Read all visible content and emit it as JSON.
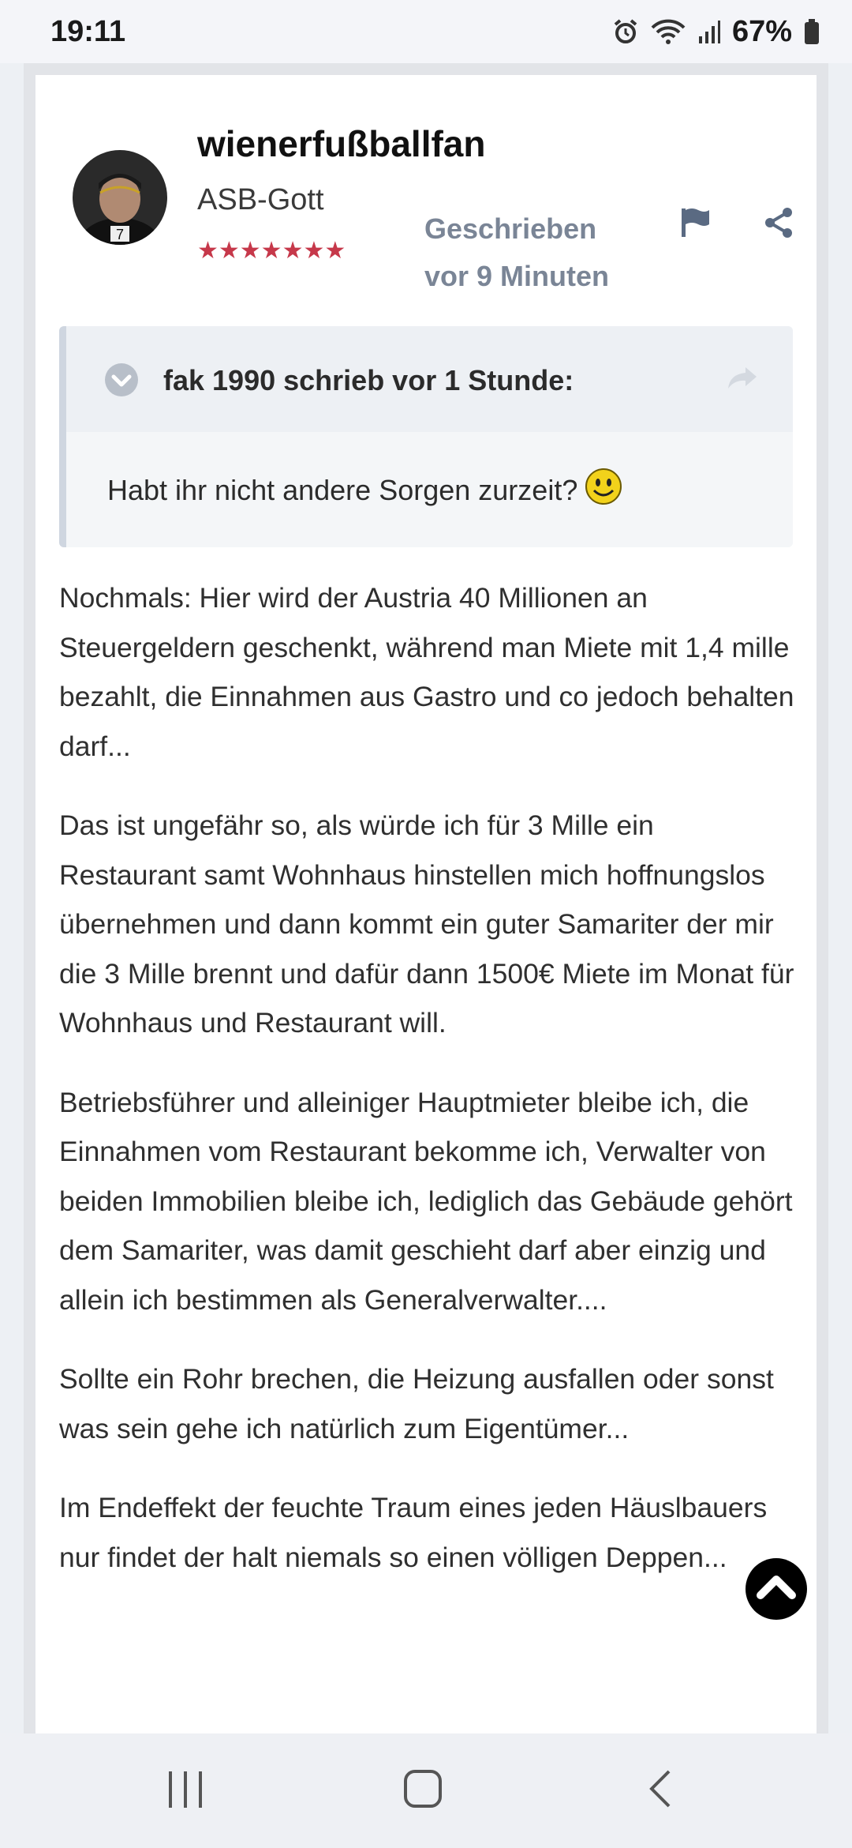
{
  "status_bar": {
    "time": "19:11",
    "battery_percent": "67%",
    "icons": [
      "alarm-icon",
      "wifi-icon",
      "signal-icon",
      "battery-icon"
    ]
  },
  "post": {
    "author": {
      "name": "wienerfußballfan",
      "rank": "ASB-Gott",
      "stars": "★★★★★★★"
    },
    "meta": {
      "line1": "Geschrieben",
      "line2": "vor 9 Minuten"
    },
    "actions": [
      "flag-icon",
      "share-icon"
    ],
    "quote": {
      "header": "fak 1990 schrieb vor 1 Stunde:",
      "text": "Habt ihr nicht andere Sorgen zurzeit?"
    },
    "paragraphs": [
      "Nochmals: Hier wird der Austria 40 Millionen an Steuergeldern geschenkt, während man Miete mit 1,4 mille bezahlt, die Einnahmen aus Gastro und co jedoch behalten darf...",
      "Das ist ungefähr so, als würde ich für 3 Mille ein Restaurant samt Wohnhaus hinstellen mich hoffnungslos übernehmen und dann kommt ein guter Samariter der mir die 3 Mille brennt und dafür dann 1500€ Miete im Monat für Wohnhaus und Restaurant will.",
      "Betriebsführer und alleiniger Hauptmieter bleibe ich, die Einnahmen vom Restaurant bekomme ich, Verwalter von beiden Immobilien bleibe ich, lediglich das Gebäude gehört dem Samariter, was damit geschieht darf aber einzig und allein ich bestimmen als Generalverwalter....",
      "Sollte ein Rohr brechen, die Heizung ausfallen oder sonst was sein gehe ich natürlich zum Eigentümer...",
      "Im Endeffekt der feuchte Traum eines jeden Häuslbauers nur findet der halt niemals so einen völligen Deppen..."
    ]
  },
  "colors": {
    "accent_meta": "#7a8596",
    "stars": "#c6384a",
    "page_bg": "#edf0f4"
  }
}
